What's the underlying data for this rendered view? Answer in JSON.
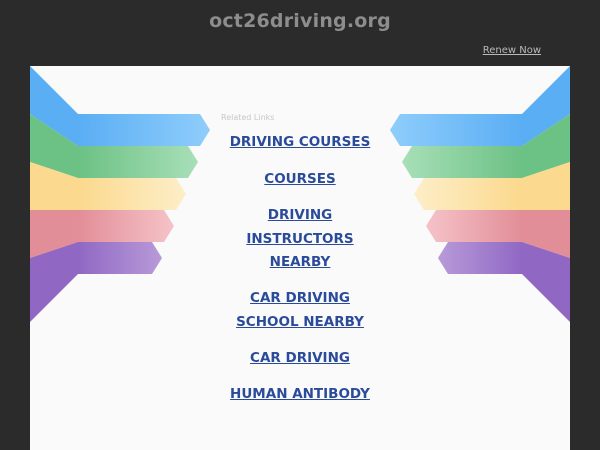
{
  "header": {
    "domain": "oct26driving.org",
    "renew_label": "Renew Now"
  },
  "panel": {
    "related_label": "Related Links",
    "links": [
      {
        "label": "DRIVING COURSES"
      },
      {
        "label": "COURSES"
      },
      {
        "label": "DRIVING INSTRUCTORS NEARBY"
      },
      {
        "label": "CAR DRIVING SCHOOL NEARBY"
      },
      {
        "label": "CAR DRIVING"
      },
      {
        "label": "HUMAN ANTIBODY"
      }
    ]
  },
  "colors": {
    "background": "#2b2b2b",
    "panel": "#fafafa",
    "link": "#2a4a9a",
    "stripes": [
      "#6bb8f5",
      "#7ccb92",
      "#fbe2a3",
      "#e69ea6",
      "#9b79c8"
    ]
  }
}
